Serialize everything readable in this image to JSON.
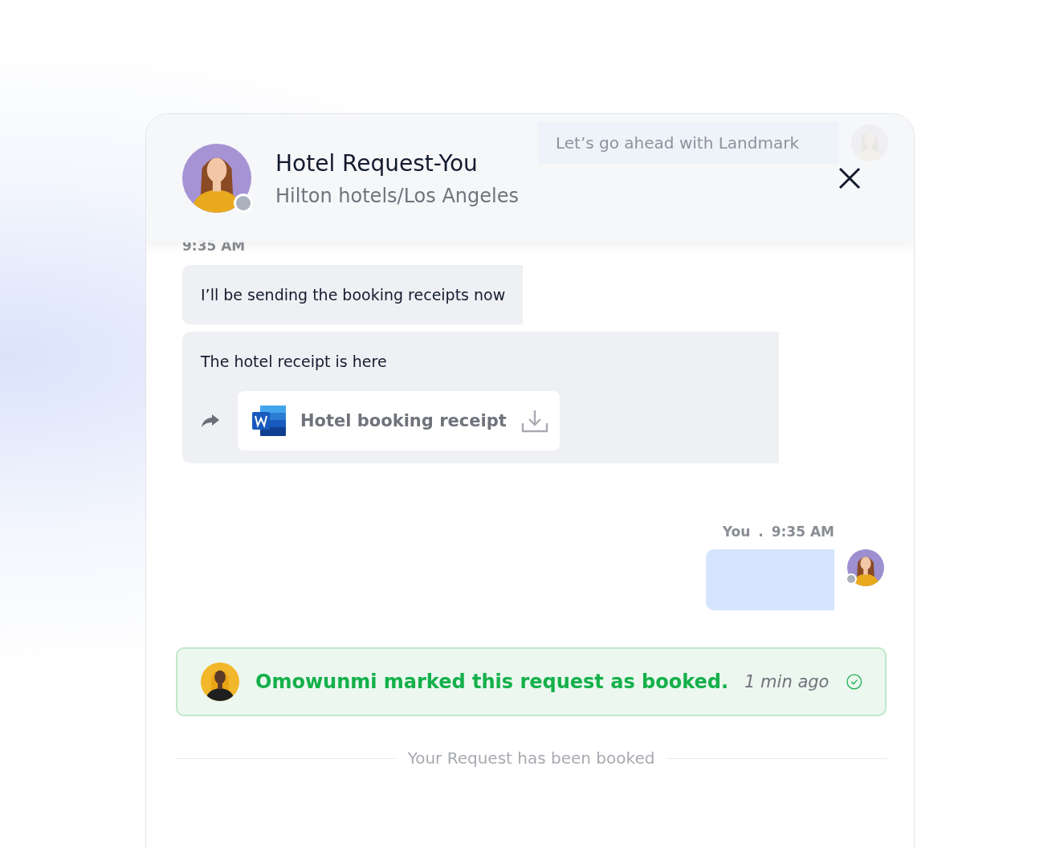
{
  "header": {
    "title": "Hotel Request-You",
    "subtitle": "Hilton hotels/Los Angeles",
    "online": false,
    "faded_message": "Let’s go ahead with Landmark"
  },
  "messages": [
    {
      "kind": "time",
      "text": "9:35 AM"
    },
    {
      "kind": "text",
      "text": "I’ll be sending the booking receipts now"
    },
    {
      "kind": "attachment",
      "text": "The hotel receipt is here",
      "file": "Hotel booking receipt"
    },
    {
      "kind": "own",
      "sender": "You",
      "separator": ".",
      "time": "9:35 AM",
      "online": false
    }
  ],
  "notice": {
    "text": "Omowunmi marked this request as booked.",
    "time": "1 min ago",
    "done": true
  },
  "divider": "Your Request has been booked"
}
